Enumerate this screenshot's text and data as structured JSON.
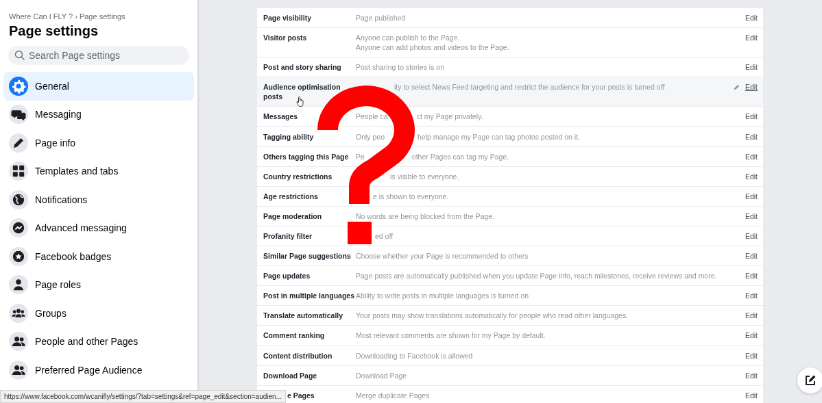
{
  "sidebar": {
    "breadcrumb": "Where Can I FLY ? › Page settings",
    "title": "Page settings",
    "search": {
      "placeholder": "Search Page settings"
    },
    "items": [
      {
        "label": "General",
        "selected": true
      },
      {
        "label": "Messaging",
        "selected": false
      },
      {
        "label": "Page info",
        "selected": false
      },
      {
        "label": "Templates and tabs",
        "selected": false
      },
      {
        "label": "Notifications",
        "selected": false
      },
      {
        "label": "Advanced messaging",
        "selected": false
      },
      {
        "label": "Facebook badges",
        "selected": false
      },
      {
        "label": "Page roles",
        "selected": false
      },
      {
        "label": "Groups",
        "selected": false
      },
      {
        "label": "People and other Pages",
        "selected": false
      },
      {
        "label": "Preferred Page Audience",
        "selected": false
      }
    ]
  },
  "settings": [
    {
      "label": "Page visibility",
      "kind": "plain",
      "description": "Page published",
      "edit": "Edit",
      "hovered": false
    },
    {
      "label": "Visitor posts",
      "kind": "plain",
      "description": "Anyone can publish to the Page.\nAnyone can add photos and videos to the Page.",
      "edit": "Edit",
      "hovered": false
    },
    {
      "label": "Post and story sharing",
      "kind": "plain",
      "description": "Post sharing to stories is on",
      "edit": "Edit",
      "hovered": false
    },
    {
      "label": "Audience optimisation\nposts",
      "kind": "tail",
      "description": "ity to select News Feed targeting and restrict the audience for your posts is turned off",
      "edit": "Edit",
      "hovered": true
    },
    {
      "label": "Messages",
      "kind": "split",
      "parts": [
        "People ca",
        "ct my Page privately."
      ],
      "edit": "Edit",
      "hovered": false
    },
    {
      "label": "Tagging ability",
      "kind": "split",
      "parts": [
        "Only peo",
        "help manage my Page can tag photos posted on it."
      ],
      "edit": "Edit",
      "hovered": false
    },
    {
      "label": "Others tagging this Page",
      "kind": "split",
      "parts": [
        "Pe",
        "other Pages can tag my Page."
      ],
      "edit": "Edit",
      "hovered": false
    },
    {
      "label": "Country restrictions",
      "kind": "tail",
      "description": "is visible to everyone.",
      "edit": "Edit",
      "hovered": false
    },
    {
      "label": "Age restrictions",
      "kind": "tail",
      "description": "e is shown to everyone.",
      "edit": "Edit",
      "hovered": false
    },
    {
      "label": "Page moderation",
      "kind": "tail",
      "description": "No words are being blocked from the Page.",
      "edit": "Edit",
      "hovered": false
    },
    {
      "label": "Profanity filter",
      "kind": "tail",
      "description": "ed off",
      "edit": "Edit",
      "hovered": false
    },
    {
      "label": "Similar Page suggestions",
      "kind": "plain",
      "description": "Choose whether your Page is recommended to others",
      "edit": "Edit",
      "hovered": false
    },
    {
      "label": "Page updates",
      "kind": "plain",
      "description": "Page posts are automatically published when you update Page info, reach milestones, receive reviews and more.",
      "edit": "Edit",
      "hovered": false
    },
    {
      "label": "Post in multiple languages",
      "kind": "plain",
      "description": "Ability to write posts in multiple languages is turned on",
      "edit": "Edit",
      "hovered": false
    },
    {
      "label": "Translate automatically",
      "kind": "plain",
      "description": "Your posts may show translations automatically for people who read other languages.",
      "edit": "Edit",
      "hovered": false
    },
    {
      "label": "Comment ranking",
      "kind": "plain",
      "description": "Most relevant comments are shown for my Page by default.",
      "edit": "Edit",
      "hovered": false
    },
    {
      "label": "Content distribution",
      "kind": "plain",
      "description": "Downloading to Facebook is allowed",
      "edit": "Edit",
      "hovered": false
    },
    {
      "label": "Download Page",
      "kind": "plain",
      "description": "Download Page",
      "edit": "Edit",
      "hovered": false
    },
    {
      "label": "e Pages",
      "kind": "tail",
      "description": "Merge duplicate Pages",
      "edit": "Edit",
      "hovered": false
    }
  ],
  "status_url": "https://www.facebook.com/wcanifly/settings/?tab=settings&ref=page_edit&section=audien..."
}
